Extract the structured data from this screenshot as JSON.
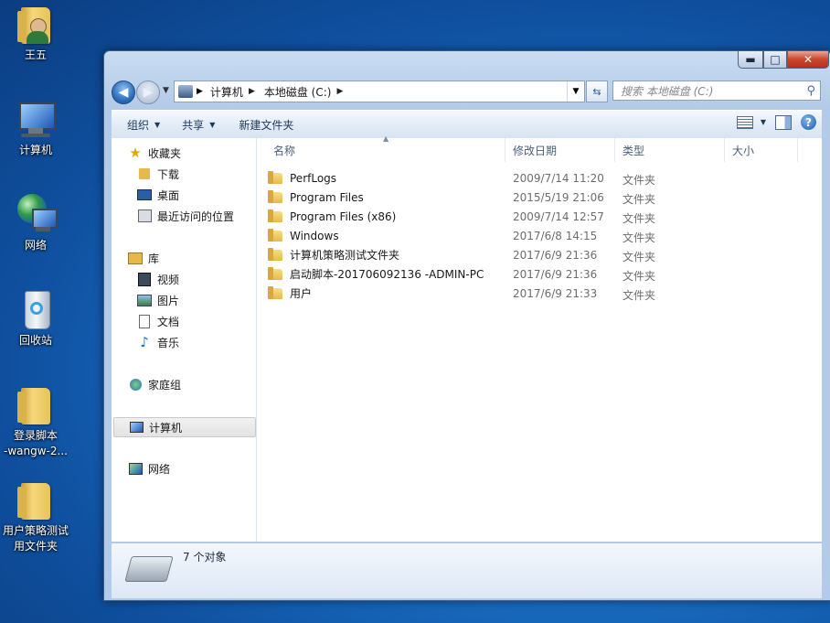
{
  "desktop": {
    "icons": [
      {
        "label": "王五",
        "kind": "user"
      },
      {
        "label": "计算机",
        "kind": "computer"
      },
      {
        "label": "网络",
        "kind": "network"
      },
      {
        "label": "回收站",
        "kind": "recycle-bin"
      },
      {
        "label": "登录脚本\n-wangw-2...",
        "line1": "登录脚本",
        "line2": "-wangw-2...",
        "kind": "folder"
      },
      {
        "label": "用户策略测试用文件夹",
        "line1": "用户策略测试",
        "line2": "用文件夹",
        "kind": "folder"
      }
    ]
  },
  "window": {
    "caption": {
      "min": "▬",
      "max": "□",
      "close": "✕"
    },
    "address": {
      "crumbs": [
        "计算机",
        "本地磁盘 (C:)"
      ]
    },
    "search": {
      "placeholder": "搜索 本地磁盘 (C:)"
    },
    "toolbar": {
      "organize": "组织",
      "share": "共享",
      "new_folder": "新建文件夹"
    },
    "nav": {
      "favorites": "收藏夹",
      "downloads": "下载",
      "desktop": "桌面",
      "recent": "最近访问的位置",
      "libraries": "库",
      "videos": "视频",
      "pictures": "图片",
      "documents": "文档",
      "music": "音乐",
      "homegroup": "家庭组",
      "computer": "计算机",
      "network": "网络"
    },
    "columns": {
      "name": "名称",
      "modified": "修改日期",
      "type": "类型",
      "size": "大小"
    },
    "files": [
      {
        "name": "PerfLogs",
        "modified": "2009/7/14 11:20",
        "type": "文件夹"
      },
      {
        "name": "Program Files",
        "modified": "2015/5/19 21:06",
        "type": "文件夹"
      },
      {
        "name": "Program Files (x86)",
        "modified": "2009/7/14 12:57",
        "type": "文件夹"
      },
      {
        "name": "Windows",
        "modified": "2017/6/8 14:15",
        "type": "文件夹"
      },
      {
        "name": "计算机策略测试文件夹",
        "modified": "2017/6/9 21:36",
        "type": "文件夹"
      },
      {
        "name": "启动脚本-201706092136 -ADMIN-PC",
        "modified": "2017/6/9 21:36",
        "type": "文件夹"
      },
      {
        "name": "用户",
        "modified": "2017/6/9 21:33",
        "type": "文件夹"
      }
    ],
    "status": {
      "count": "7 个对象"
    }
  },
  "colors": {
    "accent": "#2e6fc0",
    "folder": "#e5b94c"
  }
}
